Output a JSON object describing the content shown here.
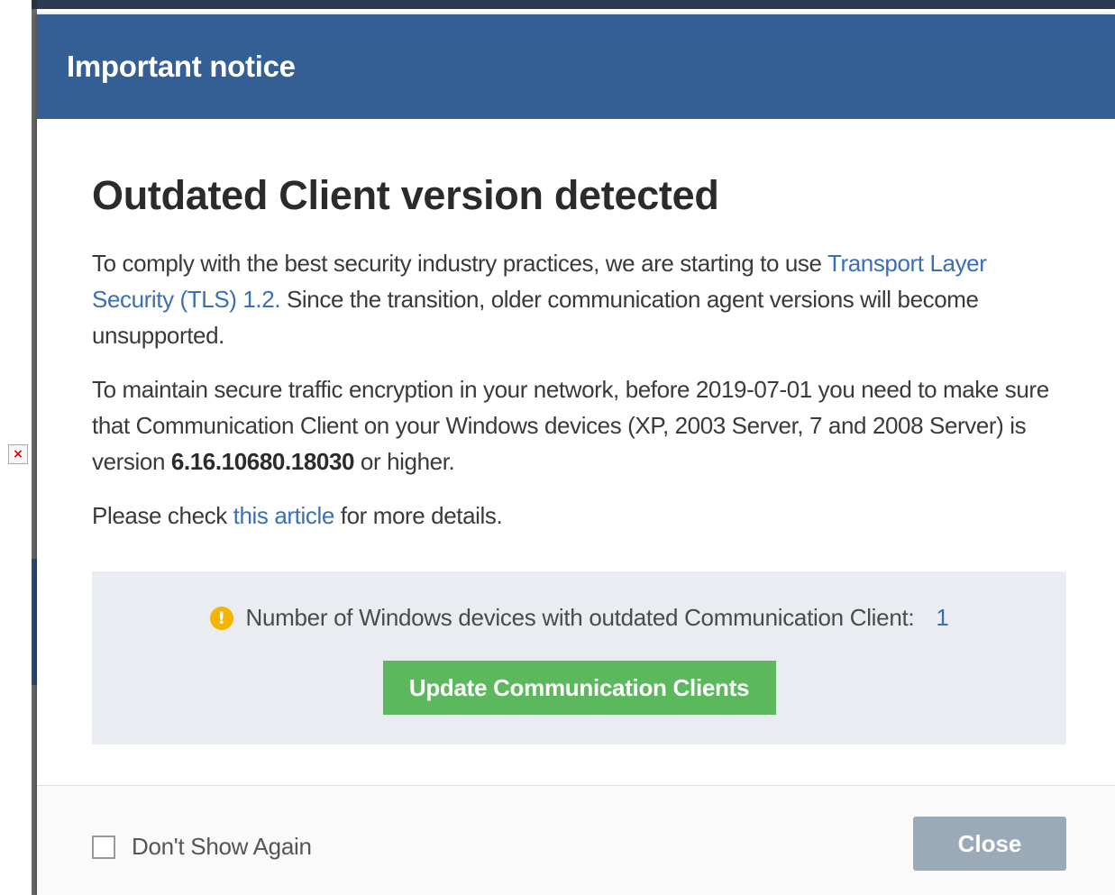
{
  "dialog": {
    "title": "Important notice",
    "heading": "Outdated Client version detected",
    "paragraph1": {
      "text_before": "To comply with the best security industry practices, we are starting to use ",
      "link": "Transport Layer Security (TLS) 1.2.",
      "text_after": " Since the transition, older communication agent versions will become unsupported."
    },
    "paragraph2": {
      "text_before": "To maintain secure traffic encryption in your network, before 2019-07-01 you need to make sure that Communication Client on your Windows devices (XP, 2003 Server, 7 and 2008 Server) is version ",
      "version": "6.16.10680.18030",
      "text_after": " or higher."
    },
    "paragraph3": {
      "text_before": "Please check ",
      "link": "this article",
      "text_after": " for more details."
    },
    "info_box": {
      "icon": "warning-icon",
      "icon_glyph": "!",
      "label": "Number of Windows devices with outdated Communication Client:",
      "count": "1",
      "button_label": "Update Communication Clients"
    },
    "footer": {
      "checkbox_label": "Don't Show Again",
      "checkbox_checked": false,
      "close_label": "Close"
    }
  },
  "broken_image_glyph": "×",
  "colors": {
    "header": "#345f95",
    "link": "#3a6fb5",
    "primary_button": "#5cb85c",
    "close_button": "#9aaab9",
    "warning": "#f5b400",
    "info_box_bg": "#e9edf1"
  }
}
